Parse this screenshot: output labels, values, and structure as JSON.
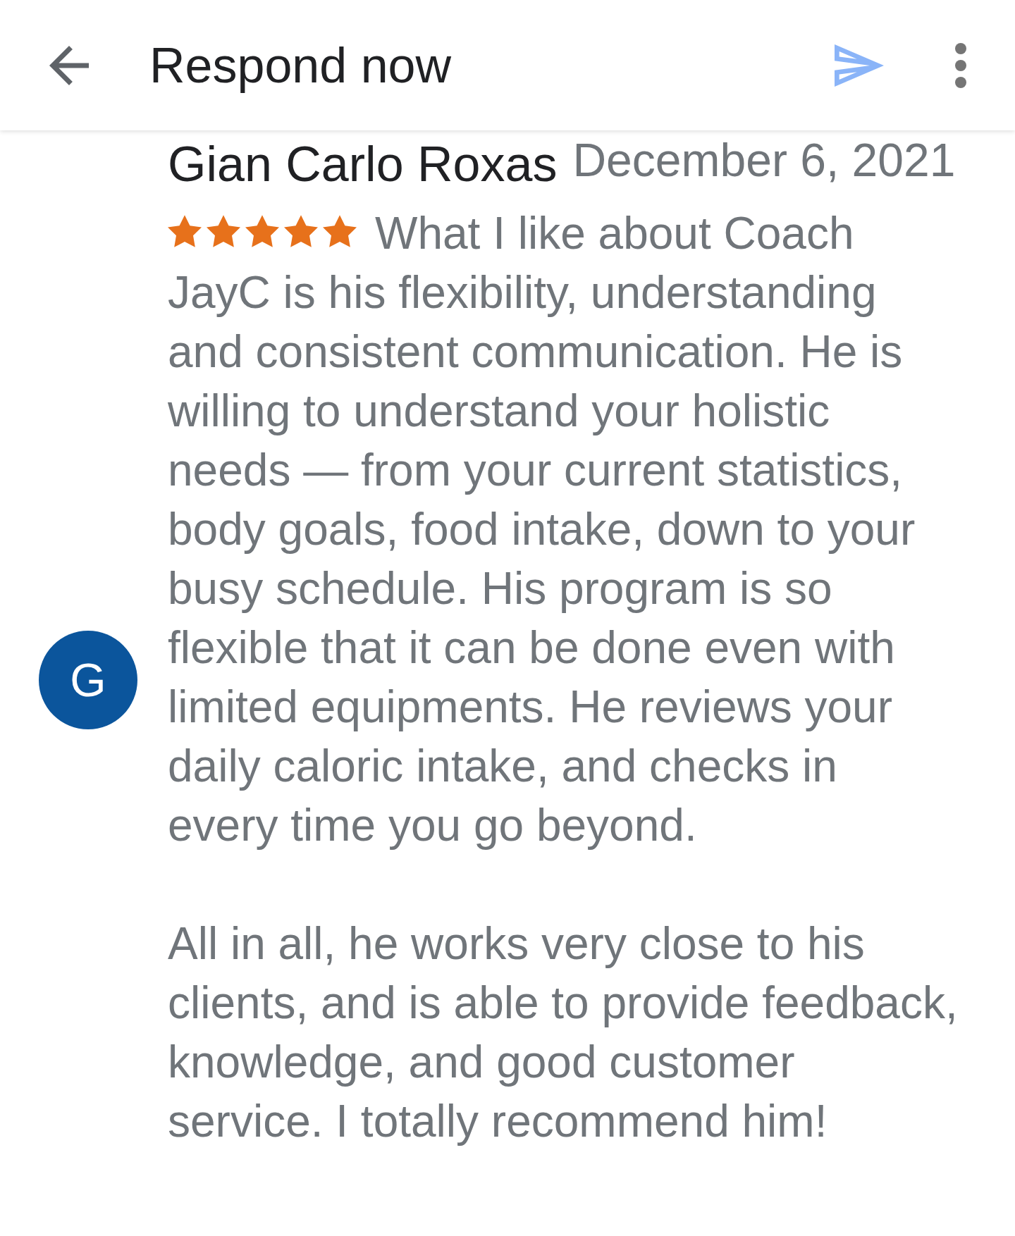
{
  "header": {
    "title": "Respond now"
  },
  "review": {
    "avatar_letter": "G",
    "author": "Gian Carlo Roxas",
    "date": "December 6, 2021",
    "stars": 5,
    "paragraphs": [
      "What I like about Coach JayC is his flexibility, understanding and consistent communication. He is willing to understand your holistic needs — from your current statistics, body goals, food intake, down to your busy schedule. His program is so flexible that it can be done even with limited equipments. He reviews your daily caloric intake, and checks in every time you go beyond.",
      "All in all, he works very close to his clients, and is able to provide feedback, knowledge, and good customer service. I totally recommend him!"
    ]
  }
}
